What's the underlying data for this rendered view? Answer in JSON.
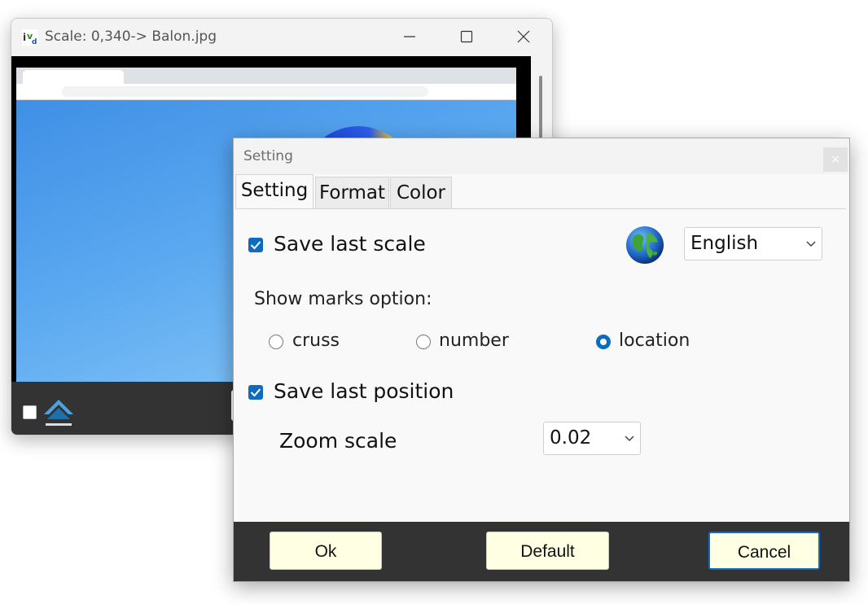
{
  "viewer": {
    "title": "Scale: 0,340-> Balon.jpg"
  },
  "dialog": {
    "title": "Setting",
    "close_label": "×",
    "tabs": [
      {
        "label": "Setting",
        "active": true
      },
      {
        "label": "Format",
        "active": false
      },
      {
        "label": "Color",
        "active": false
      }
    ],
    "save_last_scale": {
      "label": "Save last scale",
      "checked": true
    },
    "language": {
      "selected": "English",
      "icon": "globe-icon"
    },
    "show_marks": {
      "label": "Show marks option:",
      "options": [
        {
          "label": "cruss",
          "selected": false
        },
        {
          "label": "number",
          "selected": false
        },
        {
          "label": "location",
          "selected": true
        }
      ]
    },
    "save_last_position": {
      "label": "Save last position",
      "checked": true
    },
    "zoom_scale": {
      "label": "Zoom scale",
      "selected": "0.02"
    },
    "footer": {
      "ok_label": "Ok",
      "default_label": "Default",
      "cancel_label": "Cancel"
    }
  },
  "colors": {
    "accent": "#0f6cbd",
    "footer_bg": "#333333",
    "button_bg": "#ffffe4"
  }
}
